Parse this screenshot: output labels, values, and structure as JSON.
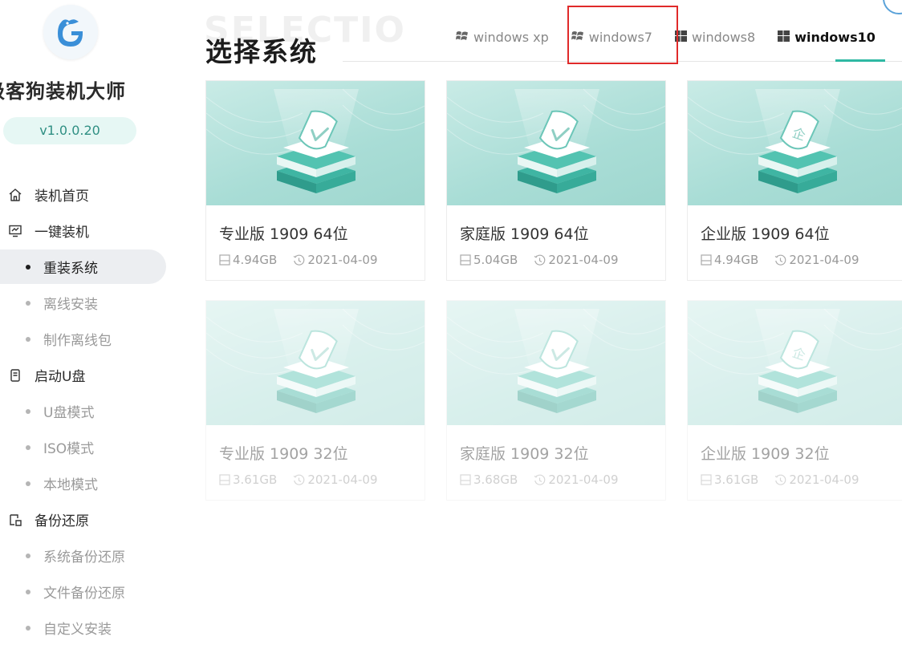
{
  "app": {
    "name": "级客狗装机大师",
    "version": "v1.0.0.20"
  },
  "sidebar": {
    "items": [
      {
        "type": "main",
        "label": "装机首页",
        "icon": "home-icon"
      },
      {
        "type": "main",
        "label": "一键装机",
        "icon": "monitor-icon"
      },
      {
        "type": "sub",
        "label": "重装系统",
        "active": true
      },
      {
        "type": "sub",
        "label": "离线安装"
      },
      {
        "type": "sub",
        "label": "制作离线包"
      },
      {
        "type": "main",
        "label": "启动U盘",
        "icon": "usb-drive-icon"
      },
      {
        "type": "sub",
        "label": "U盘模式"
      },
      {
        "type": "sub",
        "label": "ISO模式"
      },
      {
        "type": "sub",
        "label": "本地模式"
      },
      {
        "type": "main",
        "label": "备份还原",
        "icon": "backup-icon"
      },
      {
        "type": "sub",
        "label": "系统备份还原"
      },
      {
        "type": "sub",
        "label": "文件备份还原"
      },
      {
        "type": "sub",
        "label": "自定义安装"
      }
    ]
  },
  "main": {
    "bg_text": "SELECTIO",
    "title": "选择系统",
    "tabs": [
      {
        "label": "windows xp",
        "icon": "windows-legacy-icon"
      },
      {
        "label": "windows7",
        "icon": "windows-legacy-icon"
      },
      {
        "label": "windows8",
        "icon": "windows-modern-icon"
      },
      {
        "label": "windows10",
        "icon": "windows-modern-icon",
        "active": true
      }
    ],
    "highlighted_tab": "windows7",
    "cards": [
      {
        "name": "专业版 1909 64位",
        "size": "4.94GB",
        "date": "2021-04-09",
        "badge": "check",
        "faded": false
      },
      {
        "name": "家庭版 1909 64位",
        "size": "5.04GB",
        "date": "2021-04-09",
        "badge": "check",
        "faded": false
      },
      {
        "name": "企业版 1909 64位",
        "size": "4.94GB",
        "date": "2021-04-09",
        "badge": "企",
        "faded": false
      },
      {
        "name": "专业版 1909 32位",
        "size": "3.61GB",
        "date": "2021-04-09",
        "badge": "check",
        "faded": true
      },
      {
        "name": "家庭版 1909 32位",
        "size": "3.68GB",
        "date": "2021-04-09",
        "badge": "check",
        "faded": true
      },
      {
        "name": "企业版 1909 32位",
        "size": "3.61GB",
        "date": "2021-04-09",
        "badge": "企",
        "faded": true
      }
    ]
  },
  "colors": {
    "accent": "#2fb8a3",
    "highlight": "#e02a2a",
    "thumb_bg": "#b4e2dc",
    "active_nav_bg": "#eceef1"
  }
}
